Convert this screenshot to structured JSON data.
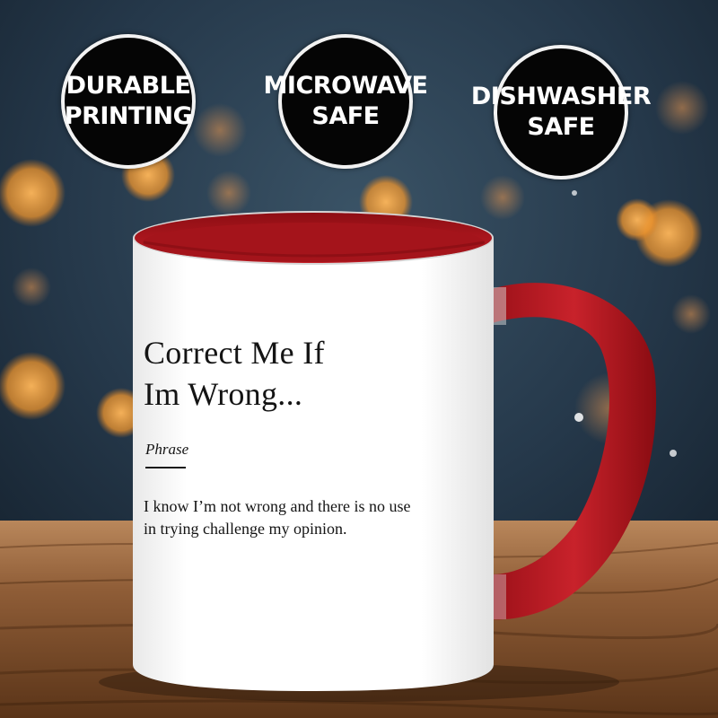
{
  "badges": [
    {
      "line1": "DURABLE",
      "line2": "PRINTING"
    },
    {
      "line1": "MICROWAVE",
      "line2": "SAFE"
    },
    {
      "line1": "DISHWASHER",
      "line2": "SAFE"
    }
  ],
  "mug": {
    "title_line1": "Correct Me If",
    "title_line2": "Im Wrong...",
    "phrase_label": "Phrase",
    "desc_line1": "I know I’m not wrong and there is no use",
    "desc_line2": "in trying challenge my opinion."
  },
  "colors": {
    "mug_accent": "#b01820",
    "badge_bg": "#050505",
    "table": "#8a5a35"
  }
}
